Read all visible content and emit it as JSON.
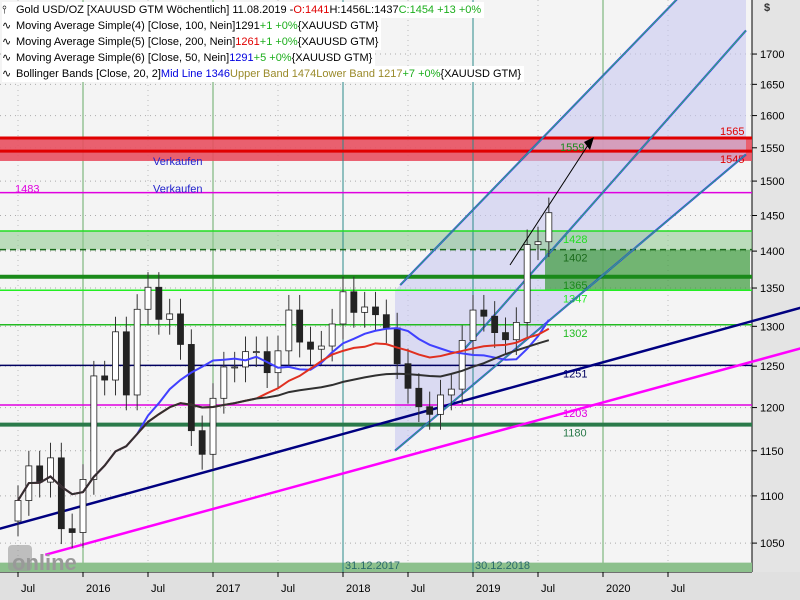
{
  "header": {
    "symbol": "Gold USD/OZ [XAUUSD GTM  Wöchentlich] 11.08.2019 -",
    "open": "O:1441",
    "high": "H:1456",
    "low": "L:1437",
    "close": "C:1454 +13 +0%",
    "currency": "$"
  },
  "legend": [
    {
      "name": "Moving Average Simple(4) [Close, 100, Nein]",
      "value": "1291",
      "change": "+1 +0%",
      "suffix": "{XAUUSD GTM}",
      "value_color": "#000000"
    },
    {
      "name": "Moving Average Simple(5) [Close, 200, Nein]",
      "value": "1261",
      "change": "+1 +0%",
      "suffix": "{XAUUSD GTM}",
      "value_color": "#e00000"
    },
    {
      "name": "Moving Average Simple(6) [Close, 50, Nein]",
      "value": "1291",
      "change": "+5 +0%",
      "suffix": "{XAUUSD GTM}",
      "value_color": "#0000e0"
    }
  ],
  "bollinger": {
    "name": "Bollinger Bands [Close, 20, 2]",
    "mid": "Mid Line 1346",
    "upper": "Upper Band 1474",
    "lower": "Lower Band 1217",
    "change": "+7 +0%",
    "suffix": "{XAUUSD GTM}"
  },
  "chart_data": {
    "type": "candlestick",
    "title": "Gold USD/OZ weekly",
    "scale": "log",
    "ylim": [
      1020,
      1780
    ],
    "yticks": [
      1050,
      1100,
      1150,
      1200,
      1250,
      1300,
      1350,
      1400,
      1450,
      1500,
      1550,
      1600,
      1650,
      1700
    ],
    "xticks": [
      {
        "label": "Jul",
        "t": 2015.5
      },
      {
        "label": "2016",
        "t": 2016.0
      },
      {
        "label": "Jul",
        "t": 2016.5
      },
      {
        "label": "2017",
        "t": 2017.0
      },
      {
        "label": "Jul",
        "t": 2017.5
      },
      {
        "label": "2018",
        "t": 2018.0
      },
      {
        "label": "Jul",
        "t": 2018.5
      },
      {
        "label": "2019",
        "t": 2019.0
      },
      {
        "label": "Jul",
        "t": 2019.5
      },
      {
        "label": "2020",
        "t": 2020.0
      },
      {
        "label": "Jul",
        "t": 2020.5
      }
    ],
    "monthly_start": 2015.5,
    "monthly_close": [
      1095,
      1133,
      1115,
      1142,
      1065,
      1061,
      1118,
      1238,
      1233,
      1293,
      1215,
      1322,
      1351,
      1309,
      1316,
      1277,
      1173,
      1146,
      1211,
      1249,
      1249,
      1268,
      1268,
      1242,
      1269,
      1321,
      1280,
      1271,
      1275,
      1303,
      1345,
      1318,
      1325,
      1315,
      1298,
      1253,
      1223,
      1201,
      1192,
      1215,
      1222,
      1282,
      1321,
      1313,
      1292,
      1283,
      1305,
      1409,
      1413,
      1454
    ],
    "levels": [
      {
        "price": 1565,
        "label": "1565",
        "color": "#e00000"
      },
      {
        "price": 1545,
        "label": "1545",
        "color": "#e00000"
      },
      {
        "price": 1483,
        "label": "1483",
        "color": "#e000e0"
      },
      {
        "price": 1428,
        "label": "1428",
        "color": "#22dd22"
      },
      {
        "price": 1402,
        "label": "1402",
        "color": "#1a6a1a"
      },
      {
        "price": 1365,
        "label": "1365",
        "color": "#1a8a1a"
      },
      {
        "price": 1347,
        "label": "1347",
        "color": "#22ee22"
      },
      {
        "price": 1302,
        "label": "1302",
        "color": "#22bb22"
      },
      {
        "price": 1251,
        "label": "1251",
        "color": "#000060"
      },
      {
        "price": 1203,
        "label": "1203",
        "color": "#e000e0"
      },
      {
        "price": 1180,
        "label": "1180",
        "color": "#2a7a4a"
      }
    ],
    "channel_label": "1559",
    "annotations": [
      {
        "text": "Verkaufen",
        "price": 1545
      },
      {
        "text": "Verkaufen",
        "price": 1483
      }
    ],
    "markers": [
      {
        "label": "31.12.2017",
        "t": 2018.0
      },
      {
        "label": "30.12.2018",
        "t": 2019.0
      }
    ],
    "trendlines": [
      {
        "name": "support-navy",
        "t1": 2015.36,
        "p1": 1065,
        "t2": 2021.52,
        "p2": 1324,
        "color": "#000080"
      },
      {
        "name": "support-magenta",
        "t1": 2015.71,
        "p1": 1038,
        "t2": 2021.52,
        "p2": 1272,
        "color": "#ff00ff"
      },
      {
        "name": "channel-upper",
        "t1": 2018.44,
        "p1": 1354,
        "t2": 2020.8,
        "p2": 1850,
        "color": "#2020ff"
      },
      {
        "name": "channel-mid",
        "t1": 2018.9,
        "p1": 1265,
        "t2": 2021.1,
        "p2": 1740,
        "color": "#2020ff"
      },
      {
        "name": "channel-lower",
        "t1": 2018.4,
        "p1": 1150,
        "t2": 2021.1,
        "p2": 1540,
        "color": "#2020ff"
      }
    ]
  },
  "watermark": "Tradesignal online"
}
